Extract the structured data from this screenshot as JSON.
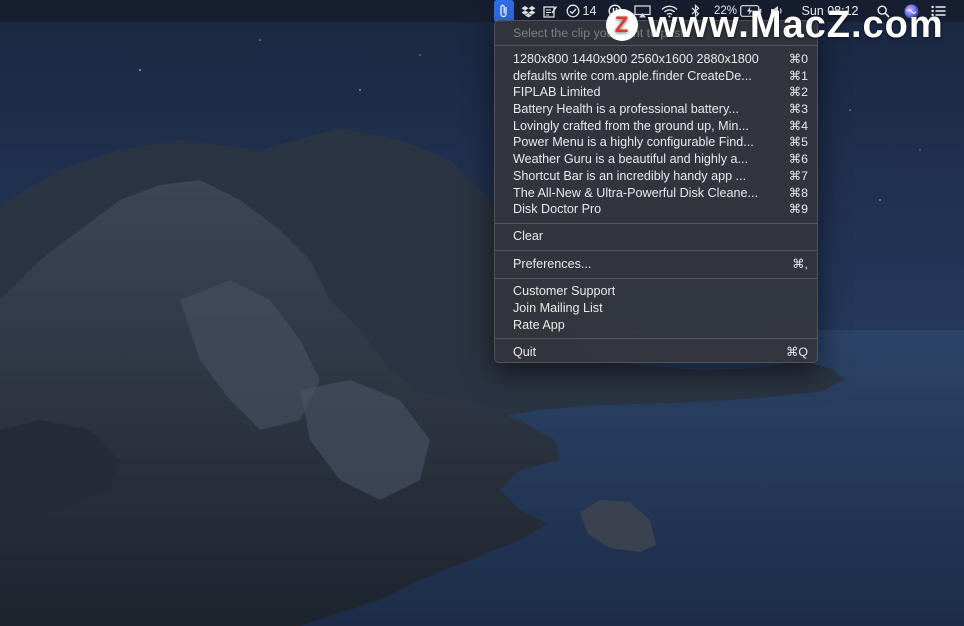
{
  "menubar": {
    "battery_percent": "22%",
    "notification_count": "14",
    "clock": "Sun 08:12"
  },
  "watermark": {
    "logo_letter": "Z",
    "text": "www.MacZ.com"
  },
  "menu": {
    "header": "Select the clip you want to paste",
    "clips": [
      {
        "label": "1280x800 1440x900 2560x1600 2880x1800",
        "shortcut": "⌘0"
      },
      {
        "label": "defaults write com.apple.finder CreateDe...",
        "shortcut": "⌘1"
      },
      {
        "label": "FIPLAB Limited",
        "shortcut": "⌘2"
      },
      {
        "label": "Battery Health is a professional battery...",
        "shortcut": "⌘3"
      },
      {
        "label": "Lovingly crafted from the ground up, Min...",
        "shortcut": "⌘4"
      },
      {
        "label": "Power Menu is a highly configurable Find...",
        "shortcut": "⌘5"
      },
      {
        "label": "Weather Guru is a beautiful and highly a...",
        "shortcut": "⌘6"
      },
      {
        "label": "Shortcut Bar is an incredibly handy app ...",
        "shortcut": "⌘7"
      },
      {
        "label": "The All-New & Ultra-Powerful Disk Cleane...",
        "shortcut": "⌘8"
      },
      {
        "label": "Disk Doctor Pro",
        "shortcut": "⌘9"
      }
    ],
    "clear_label": "Clear",
    "preferences_label": "Preferences...",
    "preferences_shortcut": "⌘,",
    "customer_support_label": "Customer Support",
    "mailing_list_label": "Join Mailing List",
    "rate_app_label": "Rate App",
    "quit_label": "Quit",
    "quit_shortcut": "⌘Q"
  }
}
